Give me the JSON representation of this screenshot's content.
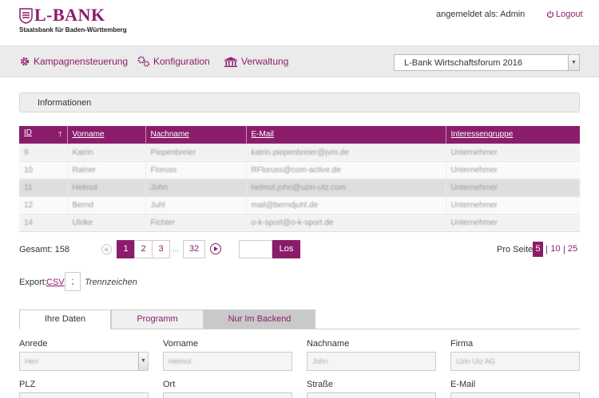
{
  "header": {
    "logo_text": "L-BANK",
    "logo_subtitle": "Staatsbank für Baden-Württemberg",
    "user_label": "angemeldet als: Admin",
    "logout_label": "Logout"
  },
  "nav": {
    "items": [
      {
        "label": "Kampagnensteuerung",
        "icon": "gear-icon"
      },
      {
        "label": "Konfiguration",
        "icon": "gears-icon"
      },
      {
        "label": "Verwaltung",
        "icon": "building-icon"
      }
    ],
    "event_select": "L-Bank Wirtschaftsforum 2016"
  },
  "info_panel": {
    "label": "Informationen"
  },
  "table": {
    "columns": [
      "ID",
      "Vorname",
      "Nachname",
      "E-Mail",
      "Interessengruppe"
    ],
    "rows": [
      [
        "9",
        "Katrin",
        "Piepenbreier",
        "katrin.piepenbreier@jvm.de",
        "Unternehmer"
      ],
      [
        "10",
        "Rainer",
        "Floruss",
        "RFloruss@com-active.de",
        "Unternehmer"
      ],
      [
        "11",
        "Helmut",
        "John",
        "helmut.john@uzin-utz.com",
        "Unternehmer"
      ],
      [
        "12",
        "Bernd",
        "Juhl",
        "mail@berndjuhl.de",
        "Unternehmer"
      ],
      [
        "14",
        "Ulrike",
        "Fichter",
        "o-k-sport@o-k-sport.de",
        "Unternehmer"
      ]
    ],
    "selected_row": 2
  },
  "pagination": {
    "total": "Gesamt: 158",
    "pages": [
      "1",
      "2",
      "3"
    ],
    "ellipsis": "...",
    "last_page": "32",
    "active_page": "1",
    "goto_button": "Los",
    "per_page_label": "Pro Seite:",
    "per_page_options": [
      "5",
      "10",
      "25"
    ],
    "per_page_active": "5"
  },
  "export": {
    "label": "Export:",
    "csv": "CSV",
    "separator": ";",
    "separator_label": "Trennzeichen"
  },
  "tabs": [
    "Ihre Daten",
    "Programm",
    "Nur Im Backend"
  ],
  "form": {
    "anrede": {
      "label": "Anrede",
      "value": "Herr"
    },
    "vorname": {
      "label": "Vorname",
      "value": "Helmut"
    },
    "nachname": {
      "label": "Nachname",
      "value": "John"
    },
    "firma": {
      "label": "Firma",
      "value": "Uzin Utz AG"
    },
    "plz": {
      "label": "PLZ"
    },
    "ort": {
      "label": "Ort"
    },
    "strasse": {
      "label": "Straße"
    },
    "email": {
      "label": "E-Mail"
    }
  },
  "colors": {
    "brand": "#8b1c6b",
    "nav_bg": "#ebebeb"
  }
}
